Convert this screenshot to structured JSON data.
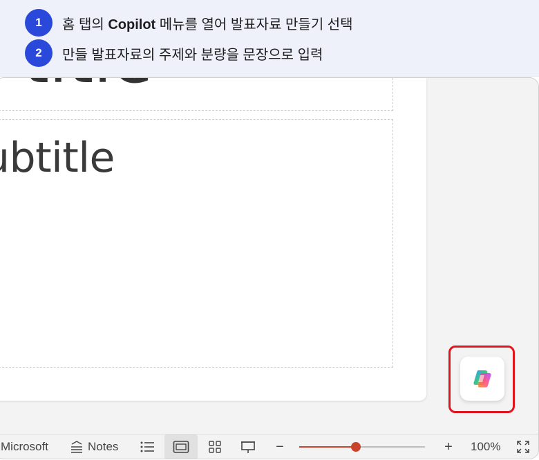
{
  "steps": [
    {
      "num": "1",
      "before": "홈 탭의 ",
      "bold": "Copilot",
      "after": " 메뉴를 열어 발표자료 만들기 선택"
    },
    {
      "num": "2",
      "text": "만들 발표자료의 주제와 분량을 문장으로 입력"
    }
  ],
  "slide": {
    "title_fragment": "a title",
    "subtitle_fragment": "ubtitle"
  },
  "statusbar": {
    "microsoft_label": "Microsoft",
    "notes_label": "Notes",
    "zoom_label": "100%",
    "zoom_level_percent": 100,
    "zoom_minus": "−",
    "zoom_plus": "+"
  },
  "colors": {
    "step_badge": "#2a48d9",
    "highlight": "#e0141c",
    "zoom_slider": "#c9442a"
  },
  "icons": {
    "copilot": "copilot-icon",
    "notes": "notes-icon",
    "outline": "outline-view-icon",
    "normal": "normal-view-icon",
    "sorter": "slide-sorter-icon",
    "presenter": "presenter-view-icon",
    "fit": "fit-to-window-icon"
  }
}
